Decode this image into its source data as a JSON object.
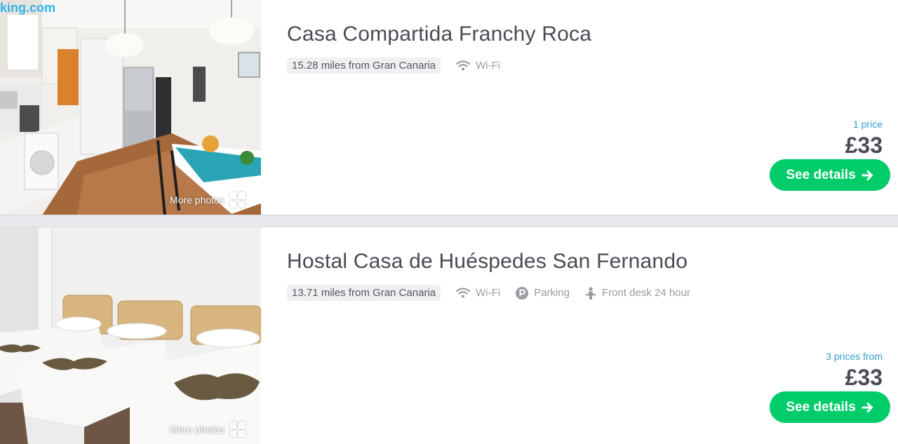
{
  "listings": [
    {
      "watermark": "king.com",
      "more_photos": "More photos",
      "title": "Casa Compartida Franchy Roca",
      "distance": "15.28 miles from Gran Canaria",
      "amenities": [
        "Wi-Fi"
      ],
      "price_count": "1 price",
      "price": "£33",
      "button": "See details"
    },
    {
      "more_photos": "More photos",
      "title": "Hostal Casa de Huéspedes San Fernando",
      "distance": "13.71 miles from Gran Canaria",
      "amenities": [
        "Wi-Fi",
        "Parking",
        "Front desk 24 hour"
      ],
      "price_count": "3 prices from",
      "price": "£33",
      "button": "See details"
    }
  ],
  "icons": {
    "wifi": "wifi-icon",
    "parking": "parking-icon",
    "front_desk": "front-desk-icon",
    "arrow": "arrow-right-icon",
    "grid": "grid-icon"
  },
  "colors": {
    "accent_green": "#00cc6a",
    "price_count_blue": "#2f9fd2",
    "title": "#4a4a54",
    "muted": "#9a9ba3"
  }
}
